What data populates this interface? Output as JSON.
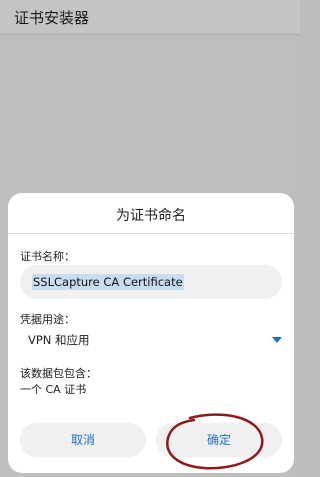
{
  "app": {
    "title": "证书安装器"
  },
  "dialog": {
    "title": "为证书命名",
    "name_label": "证书名称：",
    "name_value": "SSLCapture CA Certificate",
    "usage_label": "凭据用途：",
    "usage_value": "VPN 和应用",
    "package_label": "该数据包包含：",
    "package_contents": "一个 CA 证书",
    "cancel_label": "取消",
    "ok_label": "确定"
  },
  "colors": {
    "accent": "#1a73c8",
    "annotation": "#8b1a1a"
  }
}
